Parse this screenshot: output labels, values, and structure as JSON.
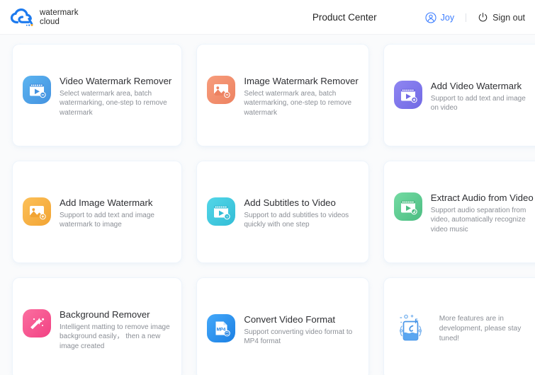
{
  "header": {
    "logo_icon": "cloud-logo-icon",
    "brand_line1": "watermark",
    "brand_line2": "cloud",
    "product_center": "Product Center",
    "user_icon": "user-circle-icon",
    "user_name": "Joy",
    "power_icon": "power-icon",
    "signout": "Sign out",
    "accent_color": "#3d7eff"
  },
  "cards": [
    {
      "title": "Video Watermark Remover",
      "desc": "Select watermark area, batch watermarking, one-step to remove watermark",
      "icon": "video-watermark-remover-icon",
      "color": "#4d9fe8",
      "color2": "#5bb2ef"
    },
    {
      "title": "Image Watermark Remover",
      "desc": "Select watermark area, batch watermarking, one-step to remove watermark",
      "icon": "image-watermark-remover-icon",
      "color": "#f08c6a",
      "color2": "#f59a7a"
    },
    {
      "title": "Add Video Watermark",
      "desc": "Support to add text and image on video",
      "icon": "add-video-watermark-icon",
      "color": "#7b72e9",
      "color2": "#8d83f0"
    },
    {
      "title": "Add Image Watermark",
      "desc": "Support to add text and image watermark to image",
      "icon": "add-image-watermark-icon",
      "color": "#f5ab3d",
      "color2": "#fbbc52"
    },
    {
      "title": "Add Subtitles to Video",
      "desc": "Support to add subtitles to videos quickly with one step",
      "icon": "add-subtitles-icon",
      "color": "#3ec6dd",
      "color2": "#51d3e6"
    },
    {
      "title": "Extract Audio from Video",
      "desc": "Support audio separation from video, automatically recognize video music",
      "icon": "extract-audio-icon",
      "color": "#5ecb8e",
      "color2": "#6ed69b"
    },
    {
      "title": "Background Remover",
      "desc": "Intelligent matting to remove image background easily， then a new image created",
      "icon": "background-remover-icon",
      "color": "#f5548c",
      "color2": "#fa6f9f"
    },
    {
      "title": "Convert Video Format",
      "desc": "Support converting video format to MP4 format",
      "icon": "convert-video-format-icon",
      "color": "#2c8ef0",
      "color2": "#3fa3f7"
    }
  ],
  "placeholder_card": {
    "art_icon": "development-illustration-icon",
    "text": "More features are in development, please stay tuned!"
  }
}
